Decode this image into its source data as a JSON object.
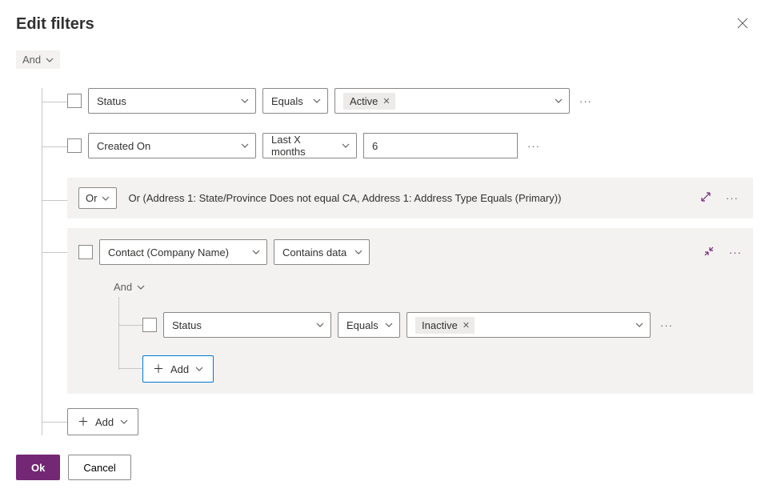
{
  "dialog": {
    "title": "Edit filters"
  },
  "root_group": "And",
  "rows": {
    "r1": {
      "field": "Status",
      "operator": "Equals",
      "value_chip": "Active"
    },
    "r2": {
      "field": "Created On",
      "operator": "Last X months",
      "value": "6"
    }
  },
  "or_block": {
    "connector": "Or",
    "summary": "Or (Address 1: State/Province Does not equal CA, Address 1: Address Type Equals (Primary))"
  },
  "nested": {
    "field": "Contact (Company Name)",
    "operator": "Contains data",
    "sub_group": "And",
    "sub_row": {
      "field": "Status",
      "operator": "Equals",
      "value_chip": "Inactive"
    }
  },
  "buttons": {
    "add": "Add",
    "ok": "Ok",
    "cancel": "Cancel"
  }
}
